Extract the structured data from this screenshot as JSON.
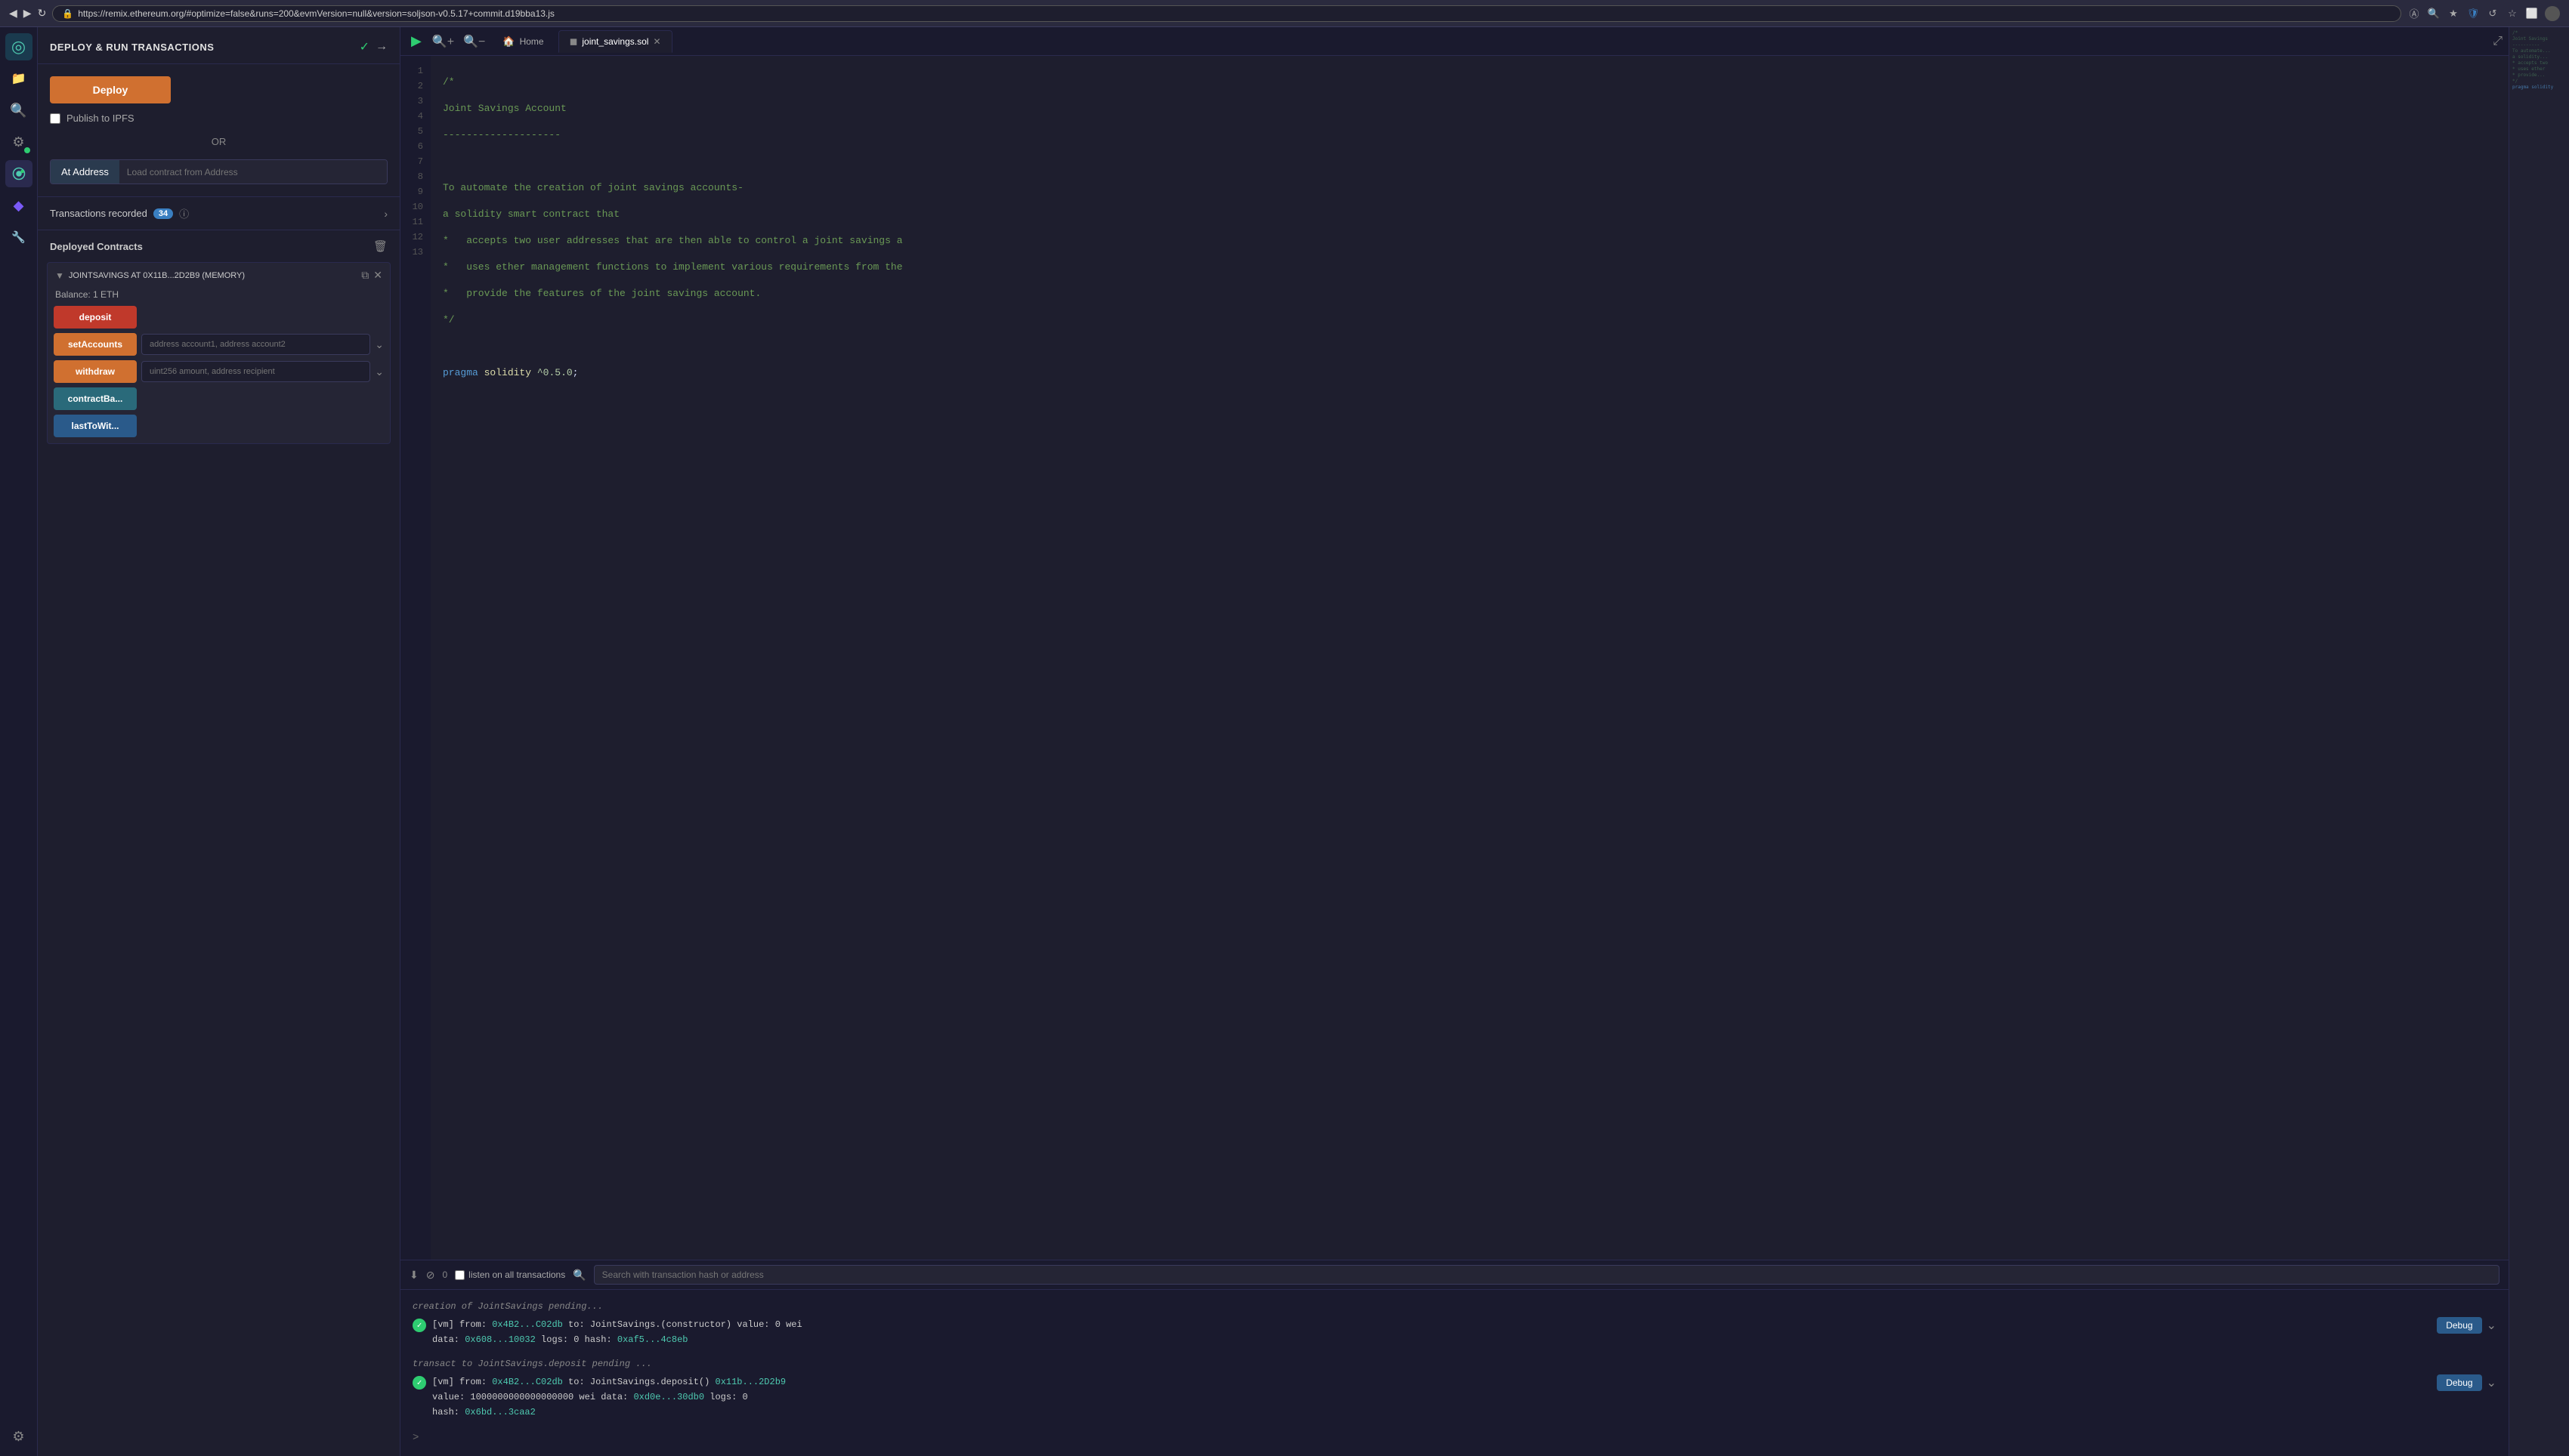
{
  "browser": {
    "back": "◀",
    "forward": "▶",
    "refresh": "↻",
    "url": "https://remix.ethereum.org/#optimize=false&runs=200&evmVersion=null&version=soljson-v0.5.17+commit.d19bba13.js",
    "lock_icon": "🔒"
  },
  "panel": {
    "title": "DEPLOY & RUN TRANSACTIONS",
    "check_icon": "✓",
    "arrow_icon": "→"
  },
  "deploy": {
    "button_label": "Deploy",
    "publish_ipfs": "Publish to IPFS",
    "or_text": "OR",
    "at_address_label": "At Address",
    "load_contract_placeholder": "Load contract from Address"
  },
  "transactions": {
    "label": "Transactions recorded",
    "count": "34"
  },
  "deployed_contracts": {
    "title": "Deployed Contracts",
    "contract_name": "JOINTSAVINGS AT 0X11B...2D2B9 (MEMORY)",
    "balance": "Balance: 1 ETH",
    "buttons": [
      {
        "id": "deposit",
        "label": "deposit",
        "style": "red",
        "has_input": false
      },
      {
        "id": "setAccounts",
        "label": "setAccounts",
        "style": "orange",
        "has_input": true,
        "placeholder": "address account1, address account2"
      },
      {
        "id": "withdraw",
        "label": "withdraw",
        "style": "orange",
        "has_input": true,
        "placeholder": "uint256 amount, address recipient"
      },
      {
        "id": "contractBa",
        "label": "contractBa...",
        "style": "teal",
        "has_input": false
      },
      {
        "id": "lastToWit",
        "label": "lastToWit...",
        "style": "blue",
        "has_input": false
      }
    ]
  },
  "tabs": [
    {
      "id": "home",
      "label": "Home",
      "icon": "🏠",
      "active": false,
      "closeable": false
    },
    {
      "id": "joint_savings",
      "label": "joint_savings.sol",
      "icon": "📄",
      "active": true,
      "closeable": true
    }
  ],
  "code": {
    "lines": [
      {
        "num": 1,
        "text": "/*",
        "type": "comment"
      },
      {
        "num": 2,
        "text": "Joint Savings Account",
        "type": "comment"
      },
      {
        "num": 3,
        "text": "--------------------",
        "type": "comment"
      },
      {
        "num": 4,
        "text": "",
        "type": "plain"
      },
      {
        "num": 5,
        "text": "To automate the creation of joint savings accounts-",
        "type": "comment"
      },
      {
        "num": 6,
        "text": "a solidity smart contract that",
        "type": "comment"
      },
      {
        "num": 7,
        "text": "*   accepts two user addresses that are then able to control a joint savings a",
        "type": "comment"
      },
      {
        "num": 8,
        "text": "*   uses ether management functions to implement various requirements from the",
        "type": "comment"
      },
      {
        "num": 9,
        "text": "*   provide the features of the joint savings account.",
        "type": "comment"
      },
      {
        "num": 10,
        "text": "*/",
        "type": "comment"
      },
      {
        "num": 11,
        "text": "",
        "type": "plain"
      },
      {
        "num": 12,
        "text": "pragma solidity ^0.5.0;",
        "type": "pragma"
      },
      {
        "num": 13,
        "text": "",
        "type": "plain"
      }
    ]
  },
  "console": {
    "fold_icon": "⬇",
    "clear_icon": "⊘",
    "count": "0",
    "listen_label": "listen on all transactions",
    "search_placeholder": "Search with transaction hash or address",
    "pending_line1": "creation of JointSavings pending...",
    "entry1": {
      "from": "0x4B2...C02db",
      "to": "JointSavings.(constructor)",
      "value": "0 wei",
      "data": "0x608...10032",
      "logs": "0",
      "hash": "0xaf5...4c8eb"
    },
    "pending_line2": "transact to JointSavings.deposit pending ...",
    "entry2": {
      "from": "0x4B2...C02db",
      "to": "JointSavings.deposit()",
      "contract": "0x11b...2D2b9",
      "value": "1000000000000000000 wei",
      "data": "0xd0e...30db0",
      "logs": "0",
      "hash": "0x6bd...3caa2"
    },
    "prompt": ">"
  },
  "sidebar_icons": [
    {
      "id": "logo",
      "icon": "◎",
      "active": true,
      "brand": true
    },
    {
      "id": "files",
      "icon": "📁",
      "active": false
    },
    {
      "id": "search",
      "icon": "🔍",
      "active": false
    },
    {
      "id": "compile",
      "icon": "⚙",
      "active": false,
      "has_badge": true
    },
    {
      "id": "deploy",
      "icon": "▶",
      "active": true
    },
    {
      "id": "debug",
      "icon": "🔷",
      "active": false
    },
    {
      "id": "plugins",
      "icon": "🔧",
      "active": false
    },
    {
      "id": "settings",
      "icon": "⚙",
      "active": false,
      "bottom": true
    }
  ]
}
